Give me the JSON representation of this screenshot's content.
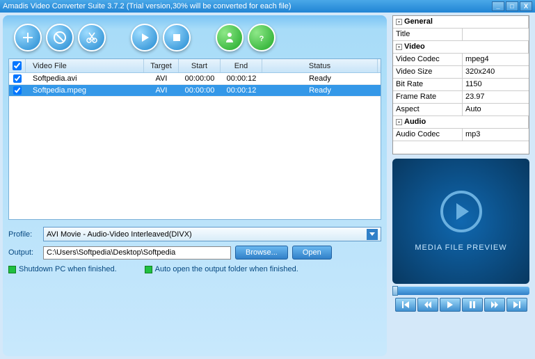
{
  "title": "Amadis Video Converter Suite 3.7.2 (Trial version,30% will be converted for each file)",
  "columns": {
    "check": "✓",
    "file": "Video File",
    "target": "Target",
    "start": "Start",
    "end": "End",
    "status": "Status"
  },
  "rows": [
    {
      "checked": true,
      "file": "Softpedia.avi",
      "target": "AVI",
      "start": "00:00:00",
      "end": "00:00:12",
      "status": "Ready",
      "selected": false
    },
    {
      "checked": true,
      "file": "Softpedia.mpeg",
      "target": "AVI",
      "start": "00:00:00",
      "end": "00:00:12",
      "status": "Ready",
      "selected": true
    }
  ],
  "profile": {
    "label": "Profile:",
    "value": "AVI Movie - Audio-Video Interleaved(DIVX)"
  },
  "output": {
    "label": "Output:",
    "value": "C:\\Users\\Softpedia\\Desktop\\Softpedia"
  },
  "buttons": {
    "browse": "Browse...",
    "open": "Open"
  },
  "checks": {
    "shutdown": "Shutdown PC when finished.",
    "autoopen": "Auto open the output folder when finished."
  },
  "props": [
    {
      "type": "cat",
      "key": "General"
    },
    {
      "key": "Title",
      "val": ""
    },
    {
      "type": "cat",
      "key": "Video"
    },
    {
      "key": "Video Codec",
      "val": "mpeg4"
    },
    {
      "key": "Video Size",
      "val": "320x240"
    },
    {
      "key": "Bit Rate",
      "val": "1150"
    },
    {
      "key": "Frame Rate",
      "val": "23.97"
    },
    {
      "key": "Aspect",
      "val": "Auto"
    },
    {
      "type": "cat",
      "key": "Audio"
    },
    {
      "key": "Audio Codec",
      "val": "mp3"
    }
  ],
  "preview": {
    "label": "MEDIA FILE PREVIEW"
  }
}
